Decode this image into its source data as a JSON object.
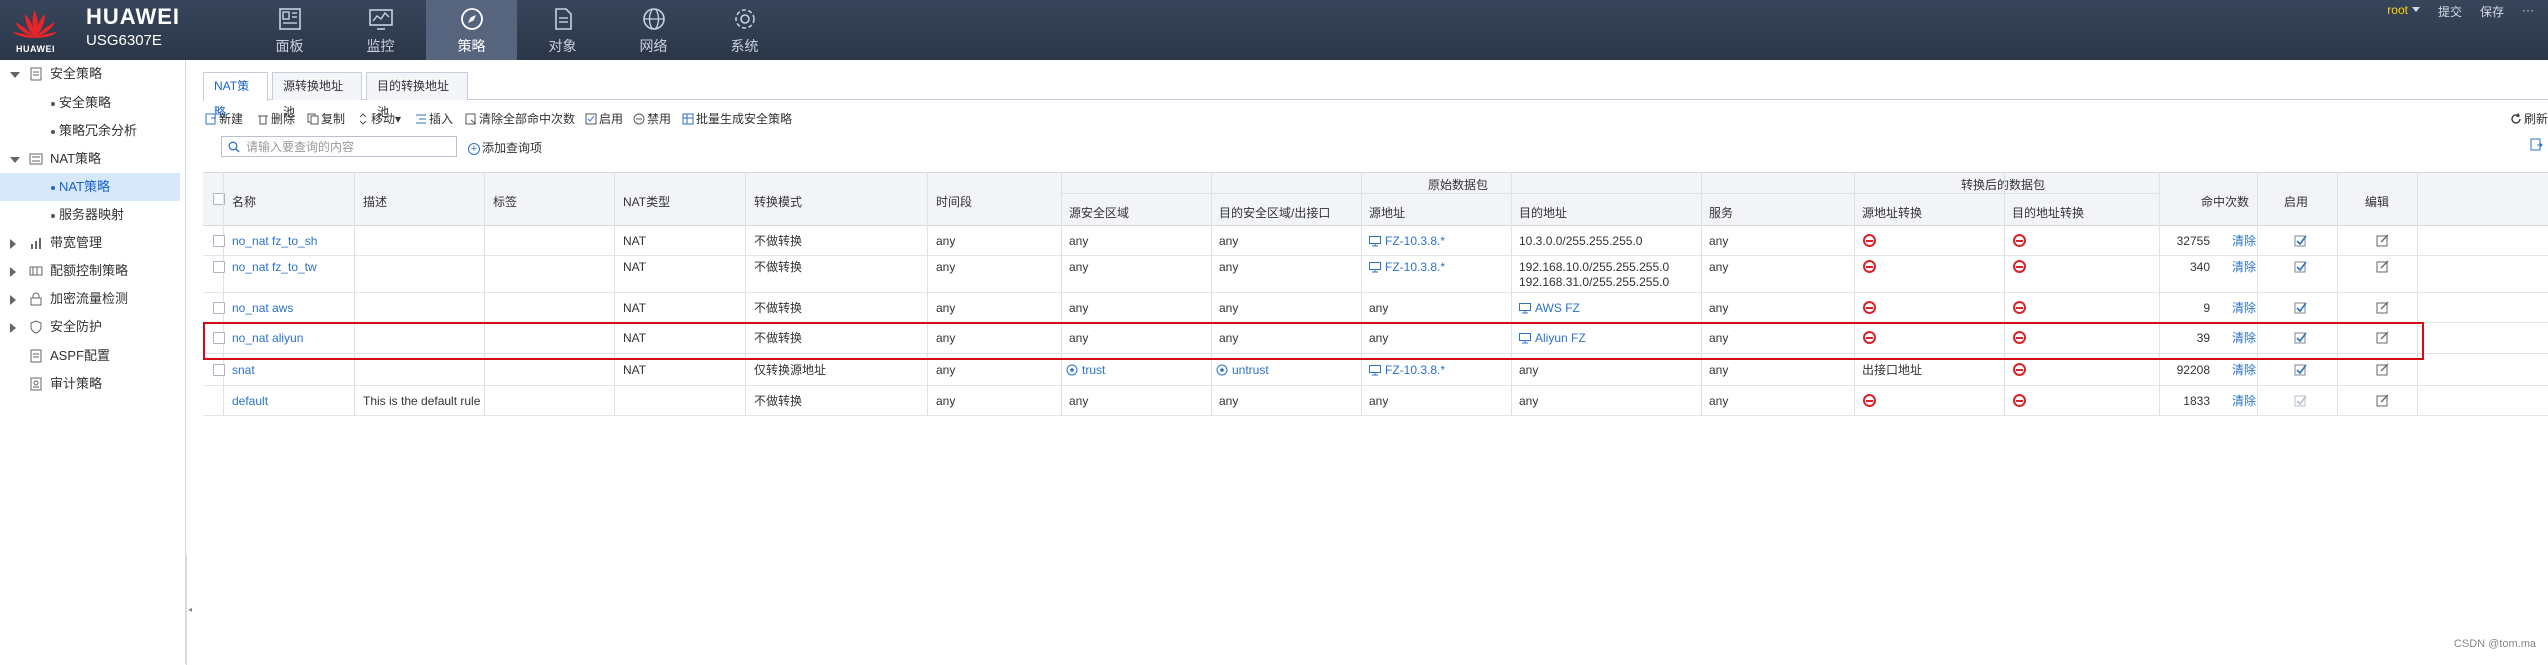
{
  "header": {
    "brand": "HUAWEI",
    "product_name": "HUAWEI",
    "product_model": "USG6307E",
    "nav": [
      {
        "label": "面板",
        "icon": "dashboard-icon"
      },
      {
        "label": "监控",
        "icon": "monitor-icon"
      },
      {
        "label": "策略",
        "icon": "compass-icon"
      },
      {
        "label": "对象",
        "icon": "object-icon"
      },
      {
        "label": "网络",
        "icon": "globe-icon"
      },
      {
        "label": "系统",
        "icon": "gear-icon"
      }
    ],
    "active_nav": "策略",
    "user": "root",
    "submit": "提交",
    "save": "保存",
    "more": "···"
  },
  "sidebar": {
    "items": [
      {
        "label": "安全策略",
        "level": 1,
        "expanded": true
      },
      {
        "label": "安全策略",
        "level": 2
      },
      {
        "label": "策略冗余分析",
        "level": 2
      },
      {
        "label": "NAT策略",
        "level": 1,
        "expanded": true
      },
      {
        "label": "NAT策略",
        "level": 2,
        "active": true
      },
      {
        "label": "服务器映射",
        "level": 2
      },
      {
        "label": "带宽管理",
        "level": 1
      },
      {
        "label": "配额控制策略",
        "level": 1
      },
      {
        "label": "加密流量检测",
        "level": 1
      },
      {
        "label": "安全防护",
        "level": 1
      },
      {
        "label": "ASPF配置",
        "level": 1
      },
      {
        "label": "审计策略",
        "level": 1
      }
    ]
  },
  "tabs": [
    "NAT策略",
    "源转换地址池",
    "目的转换地址池"
  ],
  "toolbar": {
    "new": "新建",
    "delete": "删除",
    "copy": "复制",
    "move": "移动",
    "insert": "插入",
    "clear_hits": "清除全部命中次数",
    "enable": "启用",
    "disable": "禁用",
    "batch": "批量生成安全策略",
    "refresh": "刷新"
  },
  "search": {
    "placeholder": "请输入要查询的内容",
    "add_query": "添加查询项"
  },
  "table": {
    "headers": {
      "name": "名称",
      "desc": "描述",
      "tag": "标签",
      "nat_type": "NAT类型",
      "mode": "转换模式",
      "time": "时间段",
      "orig_group": "原始数据包",
      "src_zone": "源安全区域",
      "dst_zone": "目的安全区域/出接口",
      "src_addr": "源地址",
      "dst_addr": "目的地址",
      "service": "服务",
      "trans_group": "转换后的数据包",
      "src_trans": "源地址转换",
      "dst_trans": "目的地址转换",
      "hits": "命中次数",
      "enable": "启用",
      "edit": "编辑"
    },
    "clear_label": "清除",
    "rows": [
      {
        "name": "no_nat fz_to_sh",
        "desc": "",
        "nat_type": "NAT",
        "mode": "不做转换",
        "time": "any",
        "src_zone": "any",
        "dst_zone": "any",
        "src_addr": "FZ-10.3.8.*",
        "dst_addr": [
          "10.3.0.0/255.255.255.0"
        ],
        "service": "any",
        "src_trans": "",
        "hits": "32755",
        "enabled": true
      },
      {
        "name": "no_nat fz_to_tw",
        "desc": "",
        "nat_type": "NAT",
        "mode": "不做转换",
        "time": "any",
        "src_zone": "any",
        "dst_zone": "any",
        "src_addr": "FZ-10.3.8.*",
        "dst_addr": [
          "192.168.10.0/255.255.255.0",
          "192.168.31.0/255.255.255.0"
        ],
        "service": "any",
        "src_trans": "",
        "hits": "340",
        "enabled": true
      },
      {
        "name": "no_nat aws",
        "desc": "",
        "nat_type": "NAT",
        "mode": "不做转换",
        "time": "any",
        "src_zone": "any",
        "dst_zone": "any",
        "src_addr": "any",
        "dst_addr": [
          "AWS FZ"
        ],
        "service": "any",
        "src_trans": "",
        "hits": "9",
        "enabled": true
      },
      {
        "name": "no_nat aliyun",
        "desc": "",
        "nat_type": "NAT",
        "mode": "不做转换",
        "time": "any",
        "src_zone": "any",
        "dst_zone": "any",
        "src_addr": "any",
        "dst_addr": [
          "Aliyun FZ"
        ],
        "service": "any",
        "src_trans": "",
        "hits": "39",
        "enabled": true
      },
      {
        "name": "snat",
        "desc": "",
        "nat_type": "NAT",
        "mode": "仅转换源地址",
        "time": "any",
        "src_zone": "trust",
        "dst_zone": "untrust",
        "src_addr": "FZ-10.3.8.*",
        "dst_addr": [
          "any"
        ],
        "service": "any",
        "src_trans": "出接口地址",
        "hits": "92208",
        "enabled": true
      },
      {
        "name": "default",
        "desc": "This is the default rule",
        "nat_type": "",
        "mode": "不做转换",
        "time": "any",
        "src_zone": "any",
        "dst_zone": "any",
        "src_addr": "any",
        "dst_addr": [
          "any"
        ],
        "service": "any",
        "src_trans": "",
        "hits": "1833",
        "enabled": true
      }
    ]
  },
  "watermark": "CSDN @tom.ma"
}
